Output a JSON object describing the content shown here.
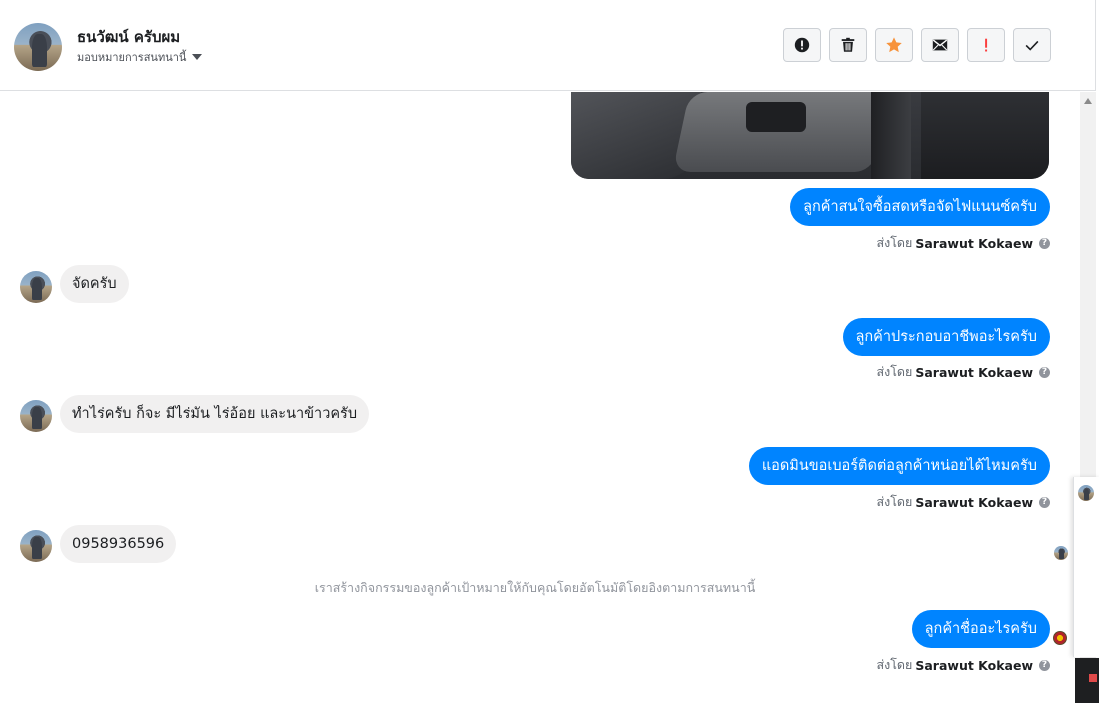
{
  "header": {
    "contact_name": "ธนวัฒน์ ครับผม",
    "assign_label": "มอบหมายการสนทนานี้"
  },
  "actions": [
    {
      "name": "spam-button",
      "icon": "alert-circle-icon"
    },
    {
      "name": "delete-button",
      "icon": "trash-icon"
    },
    {
      "name": "star-button",
      "icon": "star-icon",
      "color": "#f7923a"
    },
    {
      "name": "mark-unread-button",
      "icon": "envelope-icon"
    },
    {
      "name": "follow-up-button",
      "icon": "exclamation-icon",
      "color": "#fa3e3e"
    },
    {
      "name": "done-button",
      "icon": "check-icon"
    }
  ],
  "messages": {
    "out1": "ลูกค้าสนใจซื้อสดหรือจัดไฟแนนซ์ครับ",
    "in1": "จัดครับ",
    "out2": "ลูกค้าประกอบอาชีพอะไรครับ",
    "in2": "ทำไร่ครับ ก็จะ มีไร่มัน ไร่อ้อย และนาข้าวครับ",
    "out3": "แอดมินขอเบอร์ติดต่อลูกค้าหน่อยได้ไหมครับ",
    "in3": "0958936596",
    "system": "เราสร้างกิจกรรมของลูกค้าเป้าหมายให้กับคุณโดยอัตโนมัติโดยอิงตามการสนทนานี้",
    "out4": "ลูกค้าชื่ออะไรครับ"
  },
  "sent_by": {
    "prefix": "ส่งโดย",
    "name": "Sarawut Kokaew"
  },
  "colors": {
    "outgoing_bubble": "#0084ff",
    "incoming_bubble": "#f1f0f0"
  }
}
